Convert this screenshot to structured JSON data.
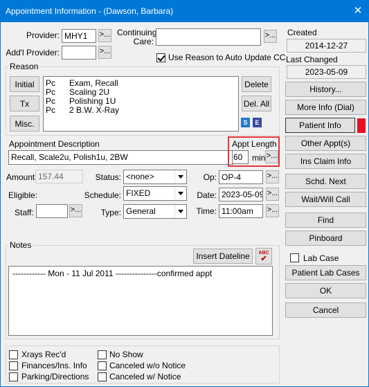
{
  "title": "Appointment Information - (Dawson, Barbara)",
  "provider": {
    "label": "Provider:",
    "value": "MHY1"
  },
  "addl_provider": {
    "label": "Add'l Provider:",
    "value": ""
  },
  "continuing_care": {
    "label": "Continuing Care:",
    "value": ""
  },
  "use_reason_checkbox": {
    "label": "Use Reason to Auto Update CC",
    "checked": true
  },
  "reason": {
    "group_label": "Reason",
    "buttons": [
      "Initial",
      "Tx",
      "Misc."
    ],
    "items": [
      {
        "code": "Pc",
        "desc": "Exam, Recall"
      },
      {
        "code": "Pc",
        "desc": "Scaling 2U"
      },
      {
        "code": "Pc",
        "desc": "Polishing 1U"
      },
      {
        "code": "Pc",
        "desc": "2 B.W. X-Ray"
      }
    ],
    "delete_label": "Delete",
    "del_all_label": "Del. All",
    "badge_s": "S",
    "badge_e": "E"
  },
  "appt_description": {
    "label": "Appointment Description",
    "value": "Recall, Scale2u, Polish1u, 2BW"
  },
  "appt_length": {
    "label": "Appt Length",
    "value": "60",
    "unit": "min"
  },
  "amount": {
    "label": "Amount:",
    "value": "157.44"
  },
  "status": {
    "label": "Status:",
    "value": "<none>"
  },
  "op": {
    "label": "Op:",
    "value": "OP-4"
  },
  "eligible": {
    "label": "Eligible:"
  },
  "schedule": {
    "label": "Schedule:",
    "value": "FIXED"
  },
  "date": {
    "label": "Date:",
    "value": "2023-05-09"
  },
  "staff": {
    "label": "Staff:",
    "value": ""
  },
  "type": {
    "label": "Type:",
    "value": "General"
  },
  "time": {
    "label": "Time:",
    "value": "11:00am"
  },
  "notes": {
    "group_label": "Notes",
    "insert_dateline_label": "Insert Dateline",
    "spell_badge": "ABC",
    "text": "------------ Mon - 11 Jul 2011 ---------------confirmed appt"
  },
  "bottom_checks": [
    {
      "label": "Xrays Rec'd",
      "checked": false
    },
    {
      "label": "Finances/Ins. Info",
      "checked": false
    },
    {
      "label": "Parking/Directions",
      "checked": false
    },
    {
      "label": "No Show",
      "checked": false
    },
    {
      "label": "Canceled w/o Notice",
      "checked": false
    },
    {
      "label": "Canceled w/ Notice",
      "checked": false
    }
  ],
  "side": {
    "created_label": "Created",
    "created_value": "2014-12-27",
    "last_changed_label": "Last Changed",
    "last_changed_value": "2023-05-09",
    "history": "History...",
    "more_info": "More Info (Dial)",
    "patient_info": "Patient Info",
    "other_appts": "Other Appt(s)",
    "ins_claim_info": "Ins Claim Info",
    "schd_next": "Schd. Next",
    "wait_will_call": "Wait/Will Call",
    "find": "Find",
    "pinboard": "Pinboard",
    "lab_case": "Lab Case",
    "patient_lab_cases": "Patient Lab Cases",
    "ok": "OK",
    "cancel": "Cancel"
  },
  "browse_glyph": ">...",
  "colors": {
    "titlebar": "#0078d7",
    "patient_flag": "#e81123",
    "highlight_border": "#e0383b"
  }
}
